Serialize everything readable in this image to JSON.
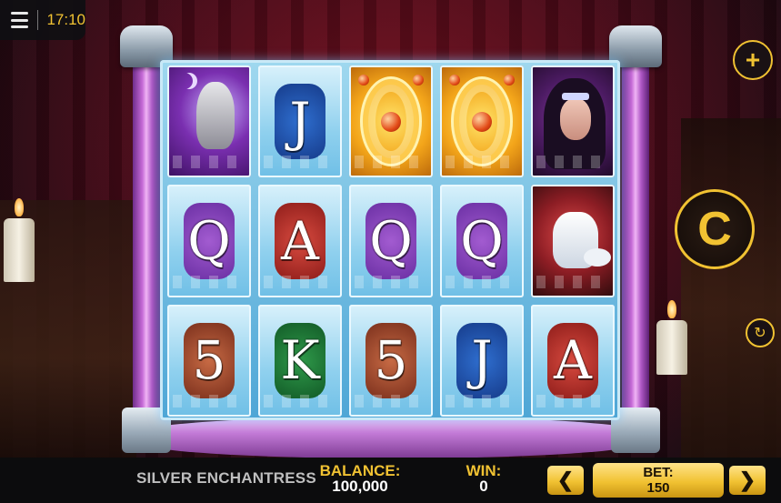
{
  "status": {
    "time": "17:10"
  },
  "reels": [
    [
      {
        "symbol": "owl-wild",
        "text": ""
      },
      {
        "symbol": "Q",
        "text": "Q",
        "color": "purple"
      },
      {
        "symbol": "5",
        "text": "5",
        "color": "brown"
      }
    ],
    [
      {
        "symbol": "J",
        "text": "J",
        "color": "blue"
      },
      {
        "symbol": "A",
        "text": "A",
        "color": "red"
      },
      {
        "symbol": "K",
        "text": "K",
        "color": "green"
      }
    ],
    [
      {
        "symbol": "golden-scatter",
        "text": ""
      },
      {
        "symbol": "Q",
        "text": "Q",
        "color": "purple"
      },
      {
        "symbol": "5",
        "text": "5",
        "color": "brown"
      }
    ],
    [
      {
        "symbol": "golden-scatter",
        "text": ""
      },
      {
        "symbol": "Q",
        "text": "Q",
        "color": "purple"
      },
      {
        "symbol": "J",
        "text": "J",
        "color": "blue"
      }
    ],
    [
      {
        "symbol": "enchantress",
        "text": ""
      },
      {
        "symbol": "white-fox",
        "text": ""
      },
      {
        "symbol": "A",
        "text": "A",
        "color": "red"
      }
    ]
  ],
  "controls": {
    "plus_icon": "+",
    "spin_icon": "C",
    "autoplay_icon": "↻"
  },
  "footer": {
    "game_title": "SILVER ENCHANTRESS",
    "balance_label": "BALANCE:",
    "balance_value": "100,000",
    "win_label": "WIN:",
    "win_value": "0",
    "bet_label": "BET:",
    "bet_value": "150",
    "bet_decrease": "❮",
    "bet_increase": "❯"
  },
  "colors": {
    "accent": "#f1c232",
    "bar": "#0c0c0d"
  }
}
